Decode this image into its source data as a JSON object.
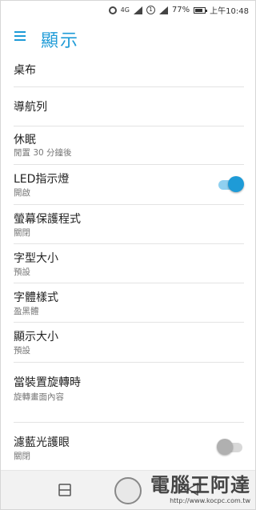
{
  "status_bar": {
    "network": "4G",
    "sim_badge": "1",
    "battery": "77%",
    "time": "上午10:48"
  },
  "header": {
    "title": "顯示"
  },
  "settings": [
    {
      "title": "桌布",
      "subtitle": ""
    },
    {
      "title": "導航列",
      "subtitle": ""
    },
    {
      "title": "休眠",
      "subtitle": "閒置 30 分鐘後"
    },
    {
      "title": "LED指示燈",
      "subtitle": "開啟",
      "toggle": true
    },
    {
      "title": "螢幕保護程式",
      "subtitle": "關閉"
    },
    {
      "title": "字型大小",
      "subtitle": "預設"
    },
    {
      "title": "字體樣式",
      "subtitle": "盈黑體"
    },
    {
      "title": "顯示大小",
      "subtitle": "預設"
    },
    {
      "title": "當裝置旋轉時",
      "subtitle": "旋轉畫面內容"
    },
    {
      "title": "濾藍光護眼",
      "subtitle": "關閉",
      "toggle": false
    }
  ],
  "colors": {
    "accent": "#1e9bd7",
    "toggle_on_track": "#8fd0f0",
    "toggle_off_track": "#d8d8d8",
    "toggle_off_knob": "#b0b0b0"
  },
  "watermark": {
    "text": "電腦王阿達",
    "url": "http://www.kocpc.com.tw"
  }
}
